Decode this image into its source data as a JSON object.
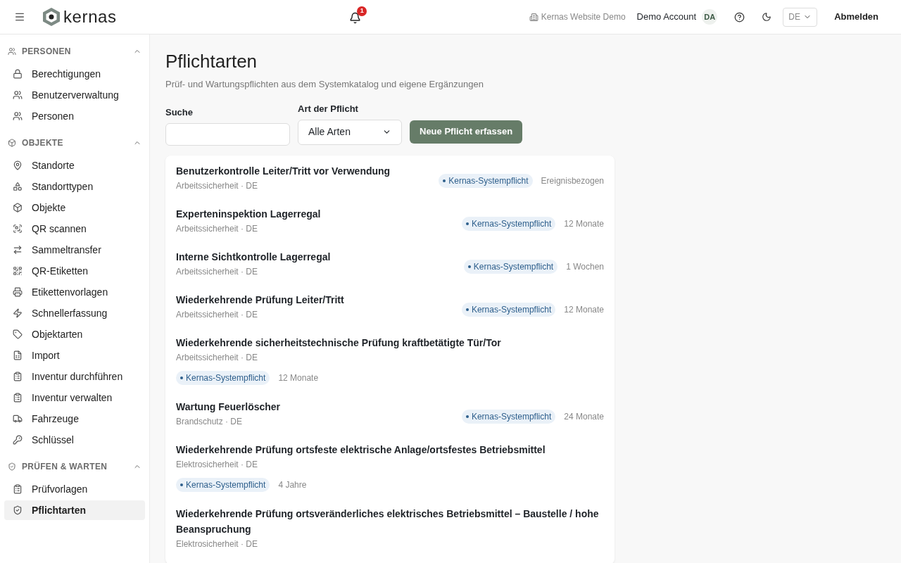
{
  "header": {
    "brand": "kernas",
    "notification_count": "1",
    "tenant": "Kernas Website Demo",
    "account": "Demo Account",
    "initials": "DA",
    "language": "DE",
    "logout": "Abmelden"
  },
  "sidebar": {
    "sections": [
      {
        "title": "PERSONEN",
        "expanded": true,
        "items": [
          {
            "label": "Berechtigungen",
            "selected": false
          },
          {
            "label": "Benutzerverwaltung",
            "selected": false
          },
          {
            "label": "Personen",
            "selected": false
          }
        ]
      },
      {
        "title": "OBJEKTE",
        "expanded": true,
        "items": [
          {
            "label": "Standorte",
            "selected": false
          },
          {
            "label": "Standorttypen",
            "selected": false
          },
          {
            "label": "Objekte",
            "selected": false
          },
          {
            "label": "QR scannen",
            "selected": false
          },
          {
            "label": "Sammeltransfer",
            "selected": false
          },
          {
            "label": "QR-Etiketten",
            "selected": false
          },
          {
            "label": "Etikettenvorlagen",
            "selected": false
          },
          {
            "label": "Schnellerfassung",
            "selected": false
          },
          {
            "label": "Objektarten",
            "selected": false
          },
          {
            "label": "Import",
            "selected": false
          },
          {
            "label": "Inventur durchführen",
            "selected": false
          },
          {
            "label": "Inventur verwalten",
            "selected": false
          },
          {
            "label": "Fahrzeuge",
            "selected": false
          },
          {
            "label": "Schlüssel",
            "selected": false
          }
        ]
      },
      {
        "title": "PRÜFEN & WARTEN",
        "expanded": true,
        "items": [
          {
            "label": "Prüfvorlagen",
            "selected": false
          },
          {
            "label": "Pflichtarten",
            "selected": true
          }
        ]
      }
    ]
  },
  "page": {
    "title": "Pflichtarten",
    "subtitle": "Prüf- und Wartungspflichten aus dem Systemkatalog und eigene Ergänzungen",
    "search": {
      "label": "Suche"
    },
    "type_filter": {
      "label": "Art der Pflicht",
      "value": "Alle Arten"
    },
    "new_button": "Neue Pflicht erfassen"
  },
  "duties": [
    {
      "title": "Benutzerkontrolle Leiter/Tritt vor Verwendung",
      "meta": "Arbeitssicherheit · DE",
      "badge": "Kernas-Systempflicht",
      "interval": "Ereignisbezogen"
    },
    {
      "title": "Experteninspektion Lagerregal",
      "meta": "Arbeitssicherheit · DE",
      "badge": "Kernas-Systempflicht",
      "interval": "12 Monate"
    },
    {
      "title": "Interne Sichtkontrolle Lagerregal",
      "meta": "Arbeitssicherheit · DE",
      "badge": "Kernas-Systempflicht",
      "interval": "1 Wochen"
    },
    {
      "title": "Wiederkehrende Prüfung Leiter/Tritt",
      "meta": "Arbeitssicherheit · DE",
      "badge": "Kernas-Systempflicht",
      "interval": "12 Monate"
    },
    {
      "title": "Wiederkehrende sicherheitstechnische Prüfung kraftbetätigte Tür/Tor",
      "meta": "Arbeitssicherheit · DE",
      "badge": "Kernas-Systempflicht",
      "interval": "12 Monate"
    },
    {
      "title": "Wartung Feuerlöscher",
      "meta": "Brandschutz · DE",
      "badge": "Kernas-Systempflicht",
      "interval": "24 Monate"
    },
    {
      "title": "Wiederkehrende Prüfung ortsfeste elektrische Anlage/ortsfestes Betriebsmittel",
      "meta": "Elektrosicherheit · DE",
      "badge": "Kernas-Systempflicht",
      "interval": "4 Jahre"
    },
    {
      "title": "Wiederkehrende Prüfung ortsveränderliches elektrisches Betriebsmittel – Baustelle / hohe Beanspruchung",
      "meta": "Elektrosicherheit · DE"
    }
  ]
}
